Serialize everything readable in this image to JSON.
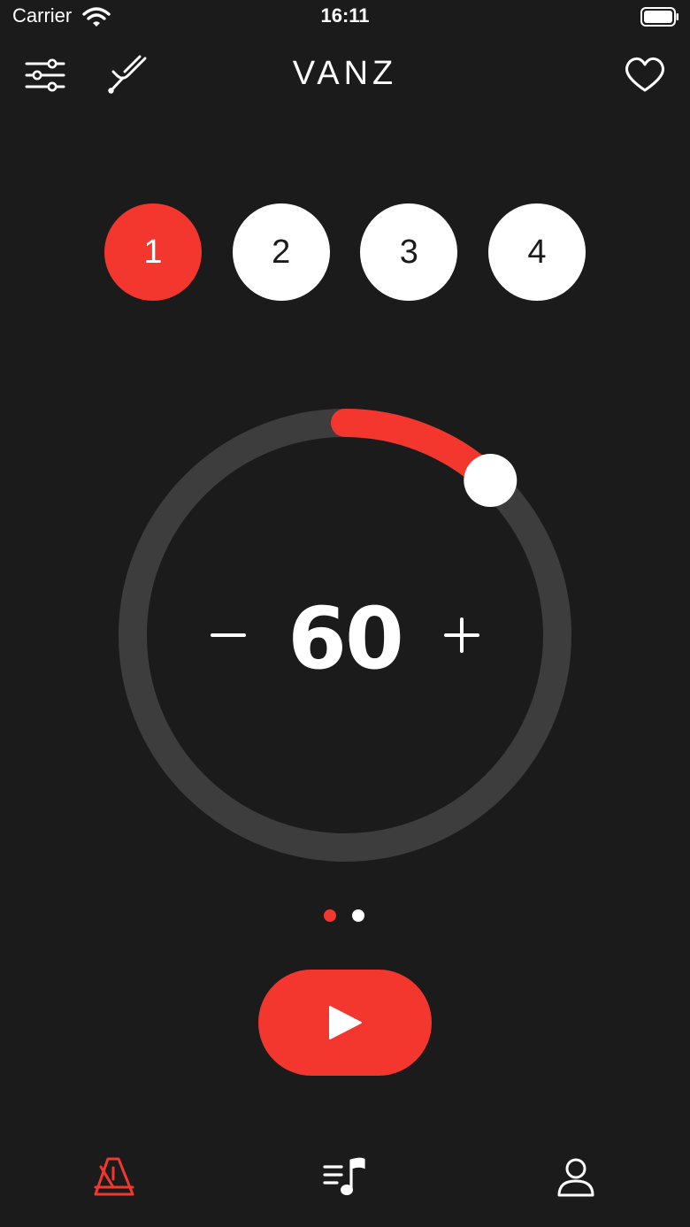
{
  "status_bar": {
    "carrier": "Carrier",
    "time": "16:11"
  },
  "header": {
    "title": "VANZ",
    "icons": [
      "sliders-icon",
      "tuning-fork-icon",
      "heart-icon"
    ]
  },
  "beats": [
    {
      "label": "1",
      "active": true
    },
    {
      "label": "2",
      "active": false
    },
    {
      "label": "3",
      "active": false
    },
    {
      "label": "4",
      "active": false
    }
  ],
  "tempo": {
    "value": "60",
    "dial_fraction": 0.12
  },
  "pagination": {
    "count": 2,
    "current": 1
  },
  "play_button": {
    "icon": "play-icon"
  },
  "tab_bar": {
    "tabs": [
      {
        "icon": "metronome-icon",
        "active": true
      },
      {
        "icon": "setlist-icon",
        "active": false
      },
      {
        "icon": "profile-icon",
        "active": false
      }
    ]
  },
  "colors": {
    "background": "#1b1b1b",
    "accent": "#f3372f",
    "track": "#3d3d3d",
    "foreground": "#ffffff"
  }
}
